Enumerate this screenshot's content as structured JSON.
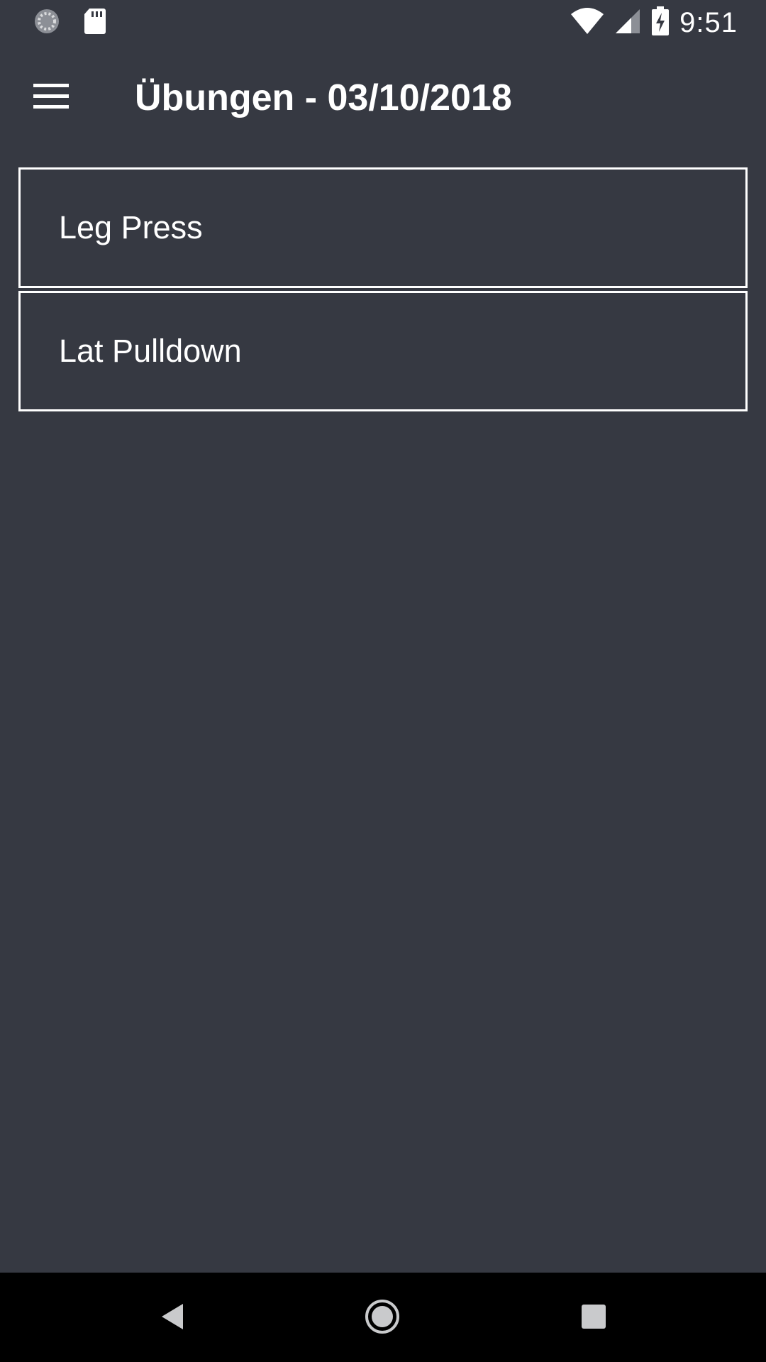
{
  "status_bar": {
    "time": "9:51",
    "left_icons": [
      "sync-icon",
      "sd-card-icon"
    ],
    "right_icons": [
      "wifi-icon",
      "cell-signal-icon",
      "battery-charging-icon"
    ]
  },
  "app_bar": {
    "menu_icon": "hamburger-menu-icon",
    "title": "Übungen - 03/10/2018"
  },
  "exercises": [
    {
      "label": "Leg Press"
    },
    {
      "label": "Lat Pulldown"
    }
  ],
  "nav_bar": {
    "buttons": [
      "back-icon",
      "home-icon",
      "recents-icon"
    ]
  },
  "colors": {
    "background": "#363942",
    "text": "#ffffff",
    "border": "#ffffff",
    "nav_background": "#000000"
  }
}
